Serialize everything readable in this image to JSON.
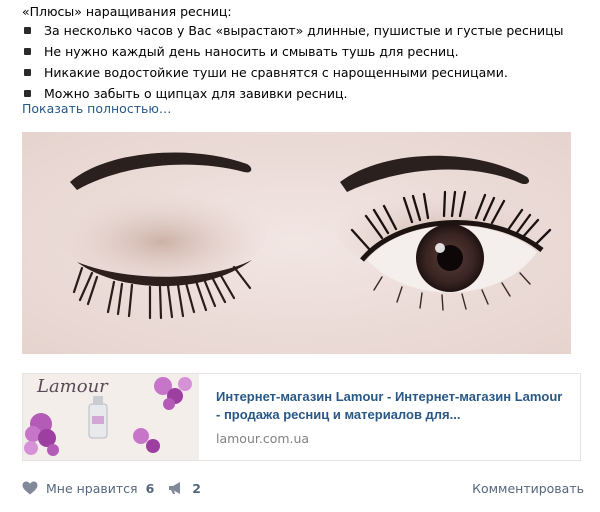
{
  "post": {
    "intro": "«Плюсы» наращивания ресниц:",
    "bullets": [
      "За несколько часов у Вас «вырастают» длинные, пушистые и густые ресницы",
      "Не нужно каждый день наносить и смывать тушь для ресниц.",
      "Никакие водостойкие туши не сравнятся с нарощенными ресницами.",
      "Можно забыть о щипцах для завивки ресниц."
    ],
    "show_more": "Показать полностью…"
  },
  "link_card": {
    "thumb_logo": "Lamour",
    "title": "Интернет-магазин Lamour - Интернет-магазин Lamour - продажа ресниц и материалов для...",
    "domain": "lamour.com.ua"
  },
  "actions": {
    "like_label": "Мне нравится",
    "like_count": "6",
    "share_count": "2",
    "comment_label": "Комментировать"
  },
  "colors": {
    "link": "#2a5885",
    "muted": "#828282",
    "action_icon": "#828a99"
  }
}
